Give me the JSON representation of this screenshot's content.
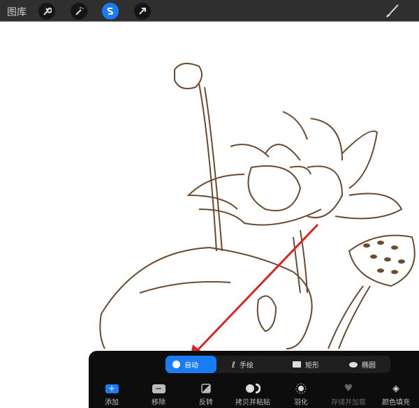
{
  "topbar": {
    "gallery_label": "图库",
    "tools": [
      "wrench-icon",
      "magic-wand-icon",
      "selection-icon",
      "transform-arrow-icon"
    ],
    "active_tool": "selection-icon",
    "brush": "brush-icon"
  },
  "selection_modes": [
    {
      "label": "自动",
      "icon": "auto-icon",
      "selected": true
    },
    {
      "label": "手绘",
      "icon": "freehand-icon"
    },
    {
      "label": "矩形",
      "icon": "rectangle-icon"
    },
    {
      "label": "椭圆",
      "icon": "ellipse-icon"
    }
  ],
  "actions": [
    {
      "label": "添加"
    },
    {
      "label": "移除"
    },
    {
      "label": "反转"
    },
    {
      "label": "拷贝并粘贴"
    },
    {
      "label": "羽化"
    },
    {
      "label": "存储并加载",
      "disabled": true
    },
    {
      "label": "颜色填充"
    }
  ],
  "colors": {
    "accent": "#1a7cf5",
    "line": "#6b4a2e",
    "arrow": "#e02020"
  }
}
